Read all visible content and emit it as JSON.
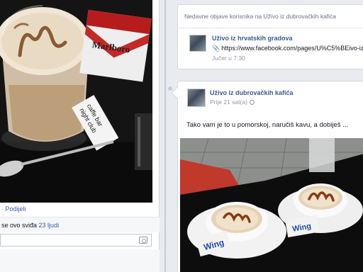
{
  "left_post": {
    "share_link": "Podijeli",
    "separator": "·",
    "likes_prefix": "se ovo sviđa",
    "likes_link": "23 ljudi",
    "photo_text": {
      "cigarette_brand": "Marlboro",
      "card_line1": "caffe bar",
      "card_line2": "night club"
    }
  },
  "recent_posts": {
    "header": "Nedavne objave korisnika na Uživo iz dubrovačkih kafića",
    "item_title": "Uživo iz hrvatskih gradova",
    "item_link": "https://www.facebook.com/pages/U%C5%BEivo-iz-h",
    "item_time": "Jučer u 7:30"
  },
  "main_post": {
    "author": "Uživo iz dubrovačkih kafića",
    "time": "Prije 21 sat(a)",
    "text": "Tako vam je to u pomorskoj, naručiš kavu, a dobiješ ...",
    "photo_text": {
      "sugar_brand": "Wing"
    }
  },
  "colors": {
    "link": "#3b5998",
    "muted": "#9197a3",
    "background": "#e9ebee"
  },
  "icons": [
    "link-icon",
    "globe-icon",
    "camera-icon"
  ]
}
